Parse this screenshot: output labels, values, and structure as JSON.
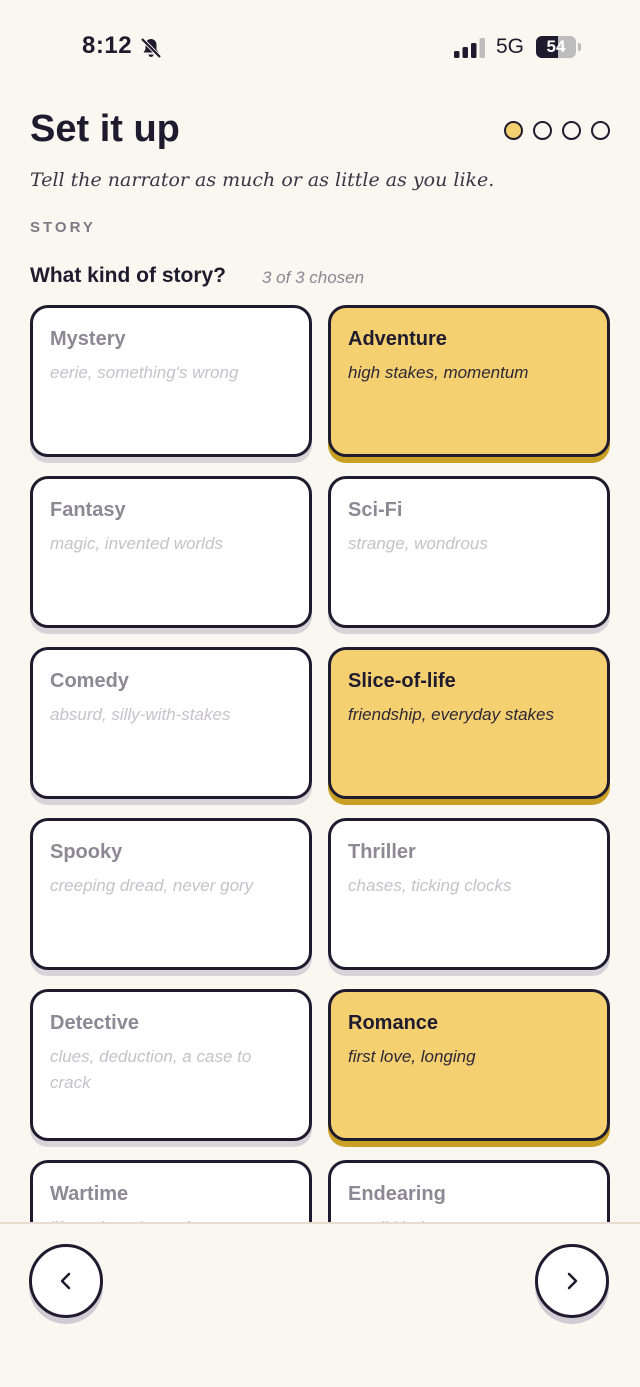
{
  "status": {
    "time": "8:12",
    "network": "5G",
    "battery": "54",
    "battery_level": 0.54
  },
  "header": {
    "title": "Set it up",
    "subtitle": "Tell the narrator as much or as little as you like.",
    "steps_total": 4,
    "step_current": 1
  },
  "section": {
    "label": "STORY"
  },
  "question": {
    "label": "What kind of story?",
    "chosen": "3 of 3 chosen"
  },
  "genres": [
    {
      "name": "Mystery",
      "desc": "eerie, something's wrong",
      "selected": false
    },
    {
      "name": "Adventure",
      "desc": "high stakes, momentum",
      "selected": true
    },
    {
      "name": "Fantasy",
      "desc": "magic, invented worlds",
      "selected": false
    },
    {
      "name": "Sci-Fi",
      "desc": "strange, wondrous",
      "selected": false
    },
    {
      "name": "Comedy",
      "desc": "absurd, silly-with-stakes",
      "selected": false
    },
    {
      "name": "Slice-of-life",
      "desc": "friendship, everyday stakes",
      "selected": true
    },
    {
      "name": "Spooky",
      "desc": "creeping dread, never gory",
      "selected": false
    },
    {
      "name": "Thriller",
      "desc": "chases, ticking clocks",
      "selected": false
    },
    {
      "name": "Detective",
      "desc": "clues, deduction, a case to crack",
      "selected": false
    },
    {
      "name": "Romance",
      "desc": "first love, longing",
      "selected": true
    },
    {
      "name": "Wartime",
      "desc": "life at the edges of war",
      "selected": false
    },
    {
      "name": "Endearing",
      "desc": "small kindnesses",
      "selected": false
    }
  ],
  "nav": {
    "back_icon": "chevron-left-icon",
    "next_icon": "chevron-right-icon"
  }
}
